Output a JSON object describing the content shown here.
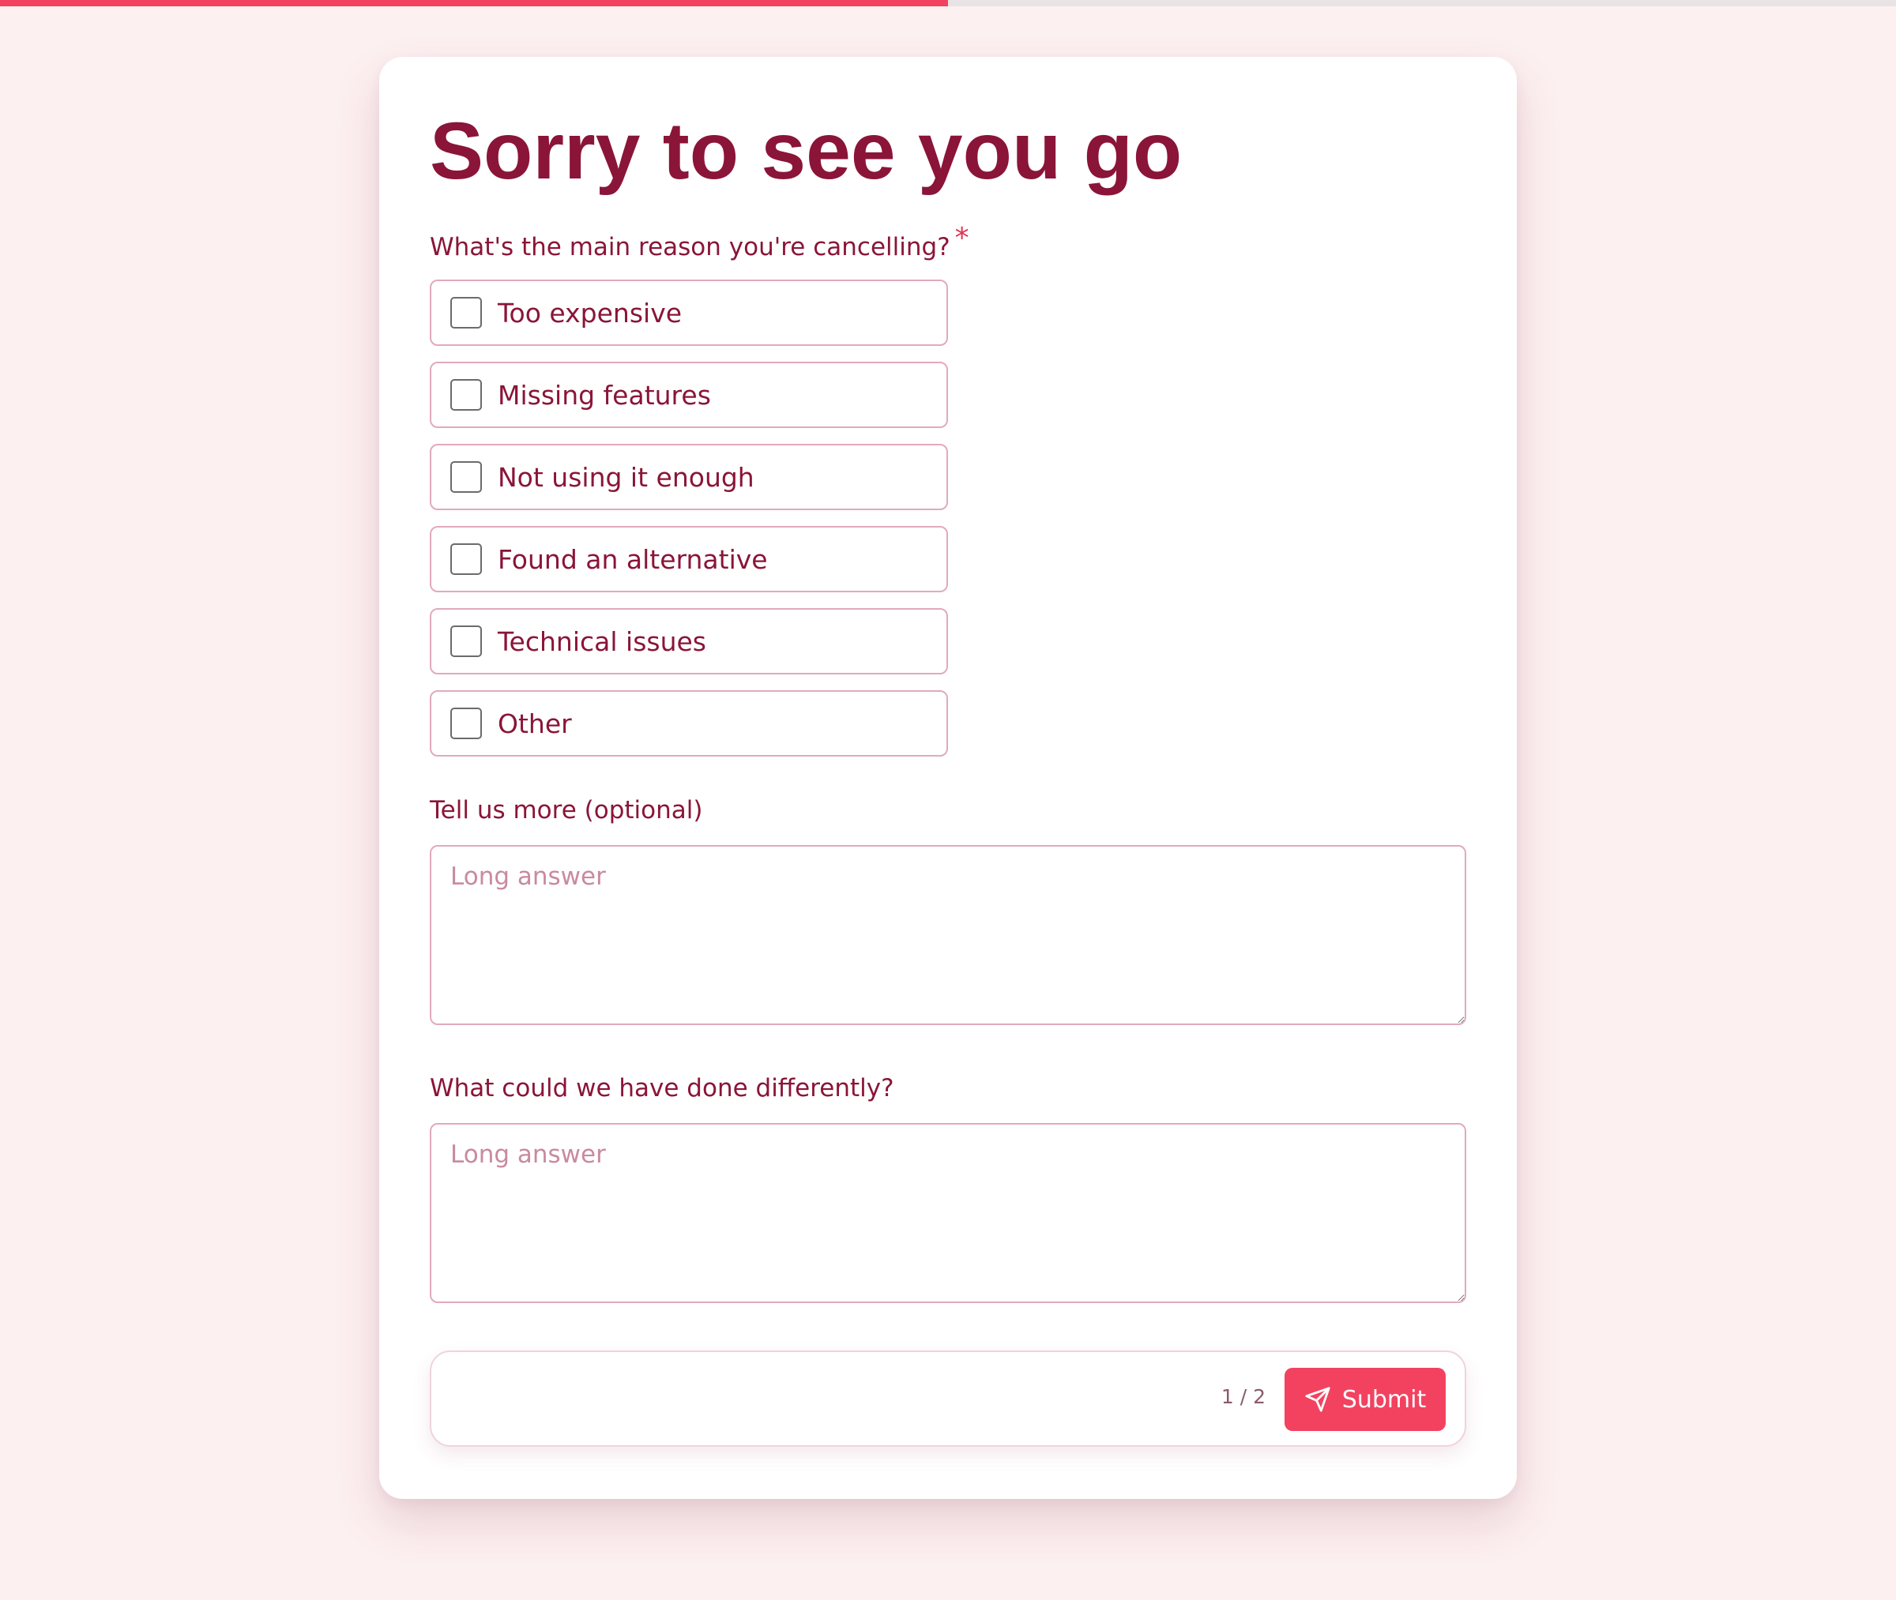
{
  "progress": {
    "fraction": 0.5
  },
  "form": {
    "title": "Sorry to see you go",
    "q1": {
      "label": "What's the main reason you're cancelling?",
      "required_marker": "*",
      "options": [
        "Too expensive",
        "Missing features",
        "Not using it enough",
        "Found an alternative",
        "Technical issues",
        "Other"
      ]
    },
    "q2": {
      "label": "Tell us more (optional)",
      "placeholder": "Long answer",
      "value": ""
    },
    "q3": {
      "label": "What could we have done differently?",
      "placeholder": "Long answer",
      "value": ""
    }
  },
  "footer": {
    "page_count": "1 / 2",
    "submit_label": "Submit",
    "submit_icon": "send-icon"
  },
  "colors": {
    "accent": "#f2425f",
    "text": "#8a1538",
    "background": "#fdf0f1",
    "border": "#e2aabb"
  }
}
